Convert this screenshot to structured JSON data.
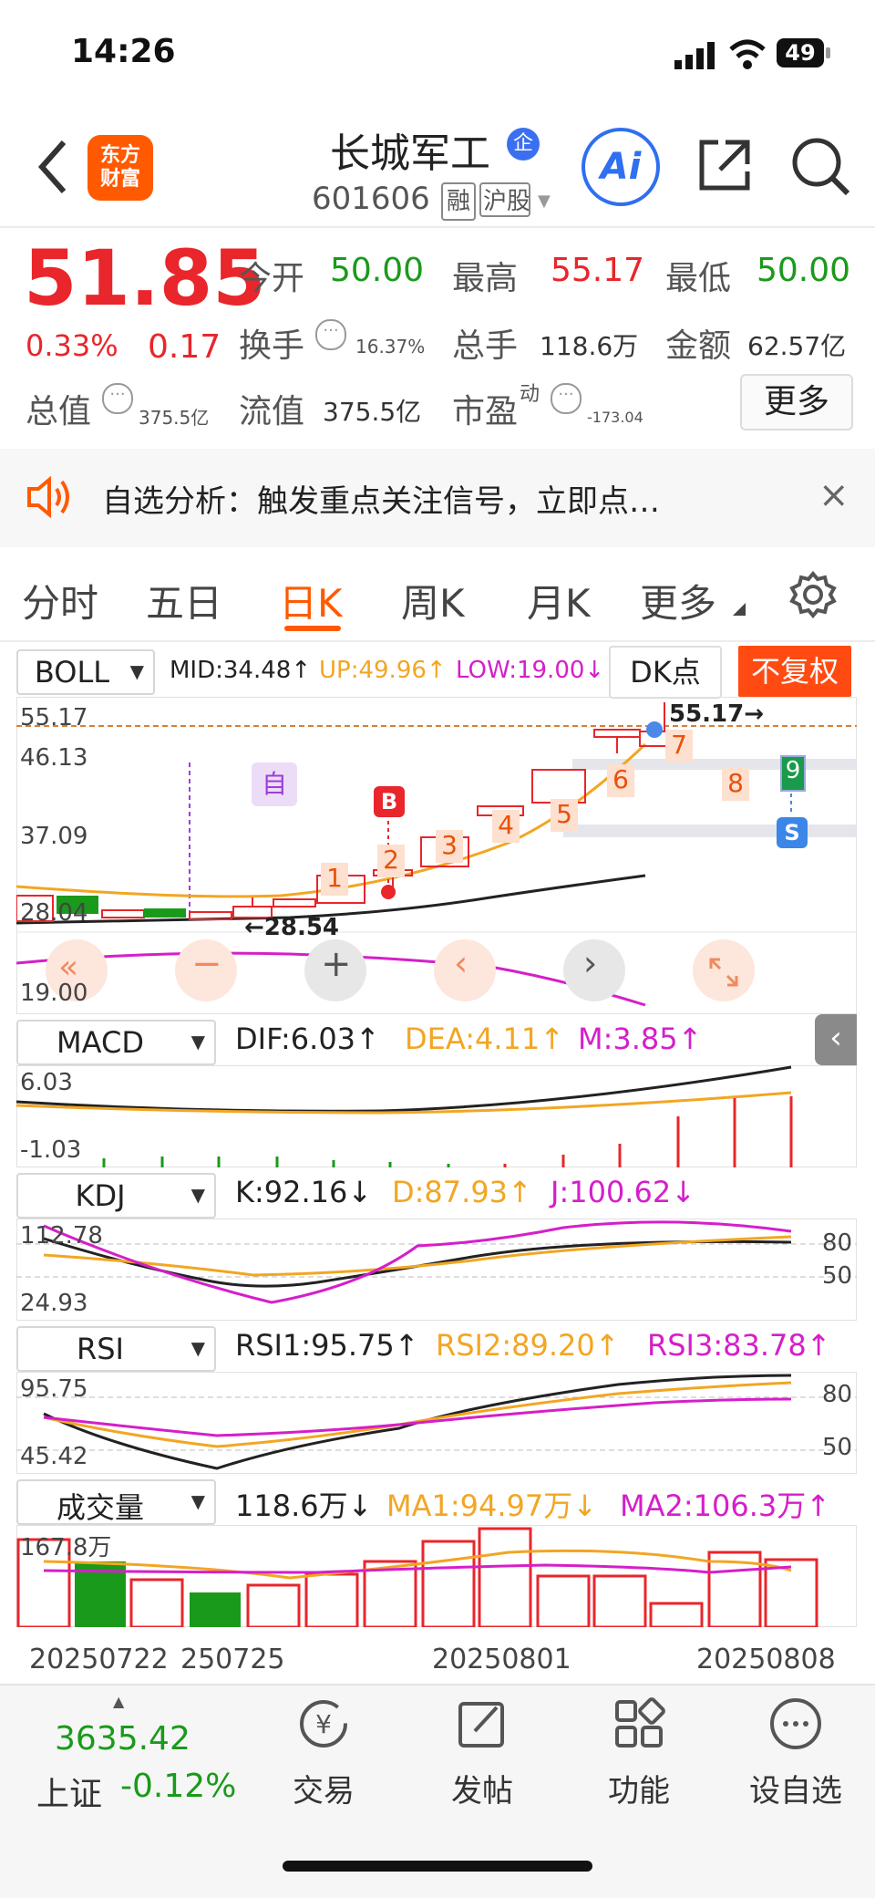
{
  "status_bar": {
    "time": "14:26",
    "battery": "49"
  },
  "header": {
    "back": "‹",
    "logo_line1": "东方",
    "logo_line2": "财富",
    "stock_name": "长城军工",
    "badge": "企",
    "code": "601606",
    "tag_margin": "融",
    "tag_market": "沪股",
    "ai_label": "Ai"
  },
  "quote": {
    "price": "51.85",
    "pct": "0.33%",
    "change": "0.17",
    "open_label": "今开",
    "open": "50.00",
    "high_label": "最高",
    "high": "55.17",
    "low_label": "最低",
    "low": "50.00",
    "turnover_label": "换手",
    "turnover": "16.37%",
    "volume_label": "总手",
    "volume": "118.6万",
    "amount_label": "金额",
    "amount": "62.57亿",
    "total_value_label": "总值",
    "total_value": "375.5亿",
    "float_value_label": "流值",
    "float_value": "375.5亿",
    "pe_label": "市盈",
    "pe_sup": "动",
    "pe": "-173.04",
    "more": "更多"
  },
  "notice": {
    "text": "自选分析：触发重点关注信号，立即点…",
    "close": "×"
  },
  "tabs": {
    "items": [
      "分时",
      "五日",
      "日K",
      "周K",
      "月K",
      "更多"
    ],
    "active": "日K"
  },
  "kline": {
    "indicator": "BOLL",
    "mid": "MID:34.48↑",
    "up": "UP:49.96↑",
    "low": "LOW:19.00↓",
    "dk": "DK点",
    "adjust": "不复权",
    "axis": [
      "55.17",
      "46.13",
      "37.09",
      "28.04",
      "19.00"
    ],
    "max_label": "55.17→",
    "min_label": "←28.54",
    "marker_self": "自",
    "marker_b": "B",
    "marker_s": "S",
    "counts": [
      "1",
      "2",
      "3",
      "4",
      "5",
      "6",
      "7",
      "8",
      "9"
    ]
  },
  "macd": {
    "name": "MACD",
    "dif": "DIF:6.03↑",
    "dea": "DEA:4.11↑",
    "m": "M:3.85↑",
    "axis": [
      "6.03",
      "-1.03"
    ]
  },
  "kdj": {
    "name": "KDJ",
    "k": "K:92.16↓",
    "d": "D:87.93↑",
    "j": "J:100.62↓",
    "axis": [
      "112.78",
      "24.93"
    ],
    "ref_high": "80",
    "ref_low": "50"
  },
  "rsi": {
    "name": "RSI",
    "rsi1": "RSI1:95.75↑",
    "rsi2": "RSI2:89.20↑",
    "rsi3": "RSI3:83.78↑",
    "axis": [
      "95.75",
      "45.42"
    ],
    "ref_high": "80",
    "ref_low": "50"
  },
  "volume": {
    "name": "成交量",
    "value": "118.6万↓",
    "ma1": "MA1:94.97万↓",
    "ma2": "MA2:106.3万↑",
    "axis_max": "167.8万"
  },
  "dates": [
    "20250722",
    "250725",
    "20250801",
    "20250808"
  ],
  "bottom": {
    "index_value": "3635.42",
    "index_name": "上证",
    "index_pct": "-0.12%",
    "trade": "交易",
    "post": "发帖",
    "func": "功能",
    "watch": "设自选"
  },
  "colors": {
    "up": "#e8262b",
    "down": "#1a9a1a",
    "accent": "#ff5a00",
    "mid_line": "#f2a623",
    "low_line": "#d51fc9"
  }
}
